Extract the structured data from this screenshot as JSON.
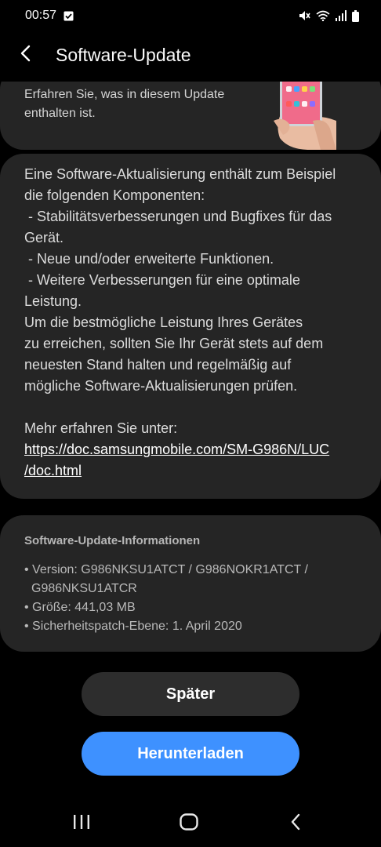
{
  "status_bar": {
    "time": "00:57",
    "icons": [
      "checkbox-notification-icon",
      "mute-icon",
      "wifi-icon",
      "signal-icon",
      "battery-icon"
    ]
  },
  "header": {
    "title": "Software-Update",
    "back_icon": "back-arrow-icon"
  },
  "promo": {
    "line1": "Erfahren Sie, was in diesem Update",
    "line2": "enthalten ist."
  },
  "description": {
    "lines": [
      "Eine Software-Aktualisierung enthält zum Beispiel",
      "die folgenden Komponenten:",
      " - Stabilitätsverbesserungen und Bugfixes für das",
      "Gerät.",
      " - Neue und/oder erweiterte Funktionen.",
      " - Weitere Verbesserungen für eine optimale",
      "Leistung.",
      "Um die bestmögliche Leistung Ihres Gerätes",
      "zu erreichen, sollten Sie Ihr Gerät stets auf dem",
      "neuesten Stand halten und regelmäßig auf",
      "mögliche Software-Aktualisierungen prüfen."
    ],
    "more_label": "Mehr erfahren Sie unter:",
    "link_line1": "https://doc.samsungmobile.com/SM-G986N/LUC",
    "link_line2": "/doc.html"
  },
  "update_info": {
    "title": "Software-Update-Informationen",
    "version_line1": "• Version: G986NKSU1ATCT / G986NOKR1ATCT /",
    "version_line2": "G986NKSU1ATCR",
    "size": "• Größe: 441,03 MB",
    "security_patch": "• Sicherheitspatch-Ebene: 1. April 2020"
  },
  "actions": {
    "later_label": "Später",
    "download_label": "Herunterladen"
  },
  "colors": {
    "background": "#000000",
    "card": "#252525",
    "accent": "#3e91ff",
    "secondary_button": "#2d2d2d"
  },
  "nav_bar": {
    "icons": [
      "recent-apps-icon",
      "home-icon",
      "back-icon"
    ]
  }
}
